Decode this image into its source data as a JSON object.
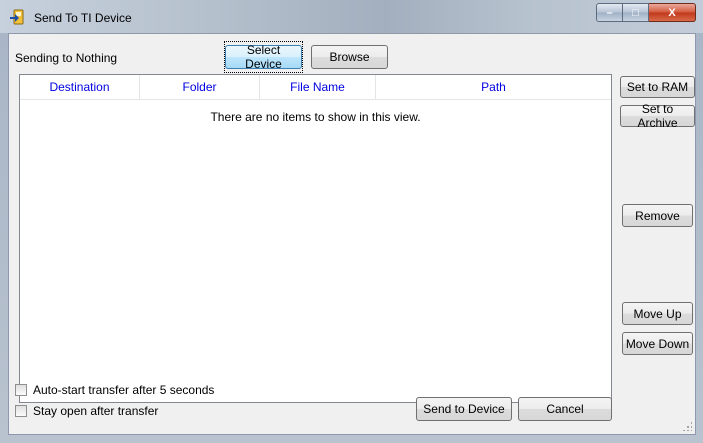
{
  "window": {
    "title": "Send To TI Device",
    "min_glyph": "–",
    "max_glyph": "□",
    "close_glyph": "X"
  },
  "status": {
    "text": "Sending to Nothing"
  },
  "top_buttons": {
    "select_device": "Select Device",
    "browse": "Browse"
  },
  "list": {
    "columns": [
      "Destination",
      "Folder",
      "File Name",
      "Path"
    ],
    "rows": [],
    "empty_message": "There are no items to show in this view."
  },
  "side_buttons": {
    "set_to_ram": "Set to RAM",
    "set_to_archive": "Set to Archive",
    "remove": "Remove",
    "move_up": "Move Up",
    "move_down": "Move Down"
  },
  "options": {
    "auto_start": {
      "label": "Auto-start transfer after 5 seconds",
      "checked": false
    },
    "stay_open": {
      "label": "Stay open after transfer",
      "checked": false
    }
  },
  "bottom_buttons": {
    "send": "Send to Device",
    "cancel": "Cancel"
  },
  "colors": {
    "header_text": "#0000e0",
    "focus_border": "#3c7fb1",
    "close_button": "#c2381b"
  }
}
